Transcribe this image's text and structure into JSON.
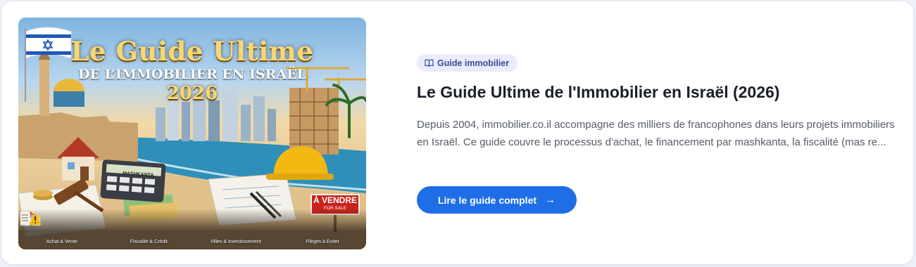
{
  "hero": {
    "title": "Le Guide Ultime",
    "subtitle": "DE L’IMMOBILIER EN ISRAËL",
    "year": "2026",
    "calculator_label": "MASHKANTA",
    "sale_sign": {
      "main": "À VENDRE",
      "sub": "FOR SALE"
    },
    "categories": [
      {
        "label": "Achat & Vente",
        "icon": "house-icon"
      },
      {
        "label": "Fiscalité & Crédit",
        "icon": "percent-coins-icon"
      },
      {
        "label": "Villes & Investissement",
        "icon": "city-icon"
      },
      {
        "label": "Pièges à Eviter",
        "icon": "warning-icon"
      }
    ]
  },
  "card": {
    "badge": {
      "icon": "book-icon",
      "label": "Guide immobilier"
    },
    "title": "Le Guide Ultime de l'Immobilier en Israël (2026)",
    "description": "Depuis 2004, immobilier.co.il accompagne des milliers de francophones dans leurs projets immobiliers en Israël. Ce guide couvre le processus d'achat, le financement par mashkanta, la fiscalité (mas re...",
    "cta": {
      "label": "Lire le guide complet",
      "icon": "arrow-right-icon"
    }
  },
  "colors": {
    "accent": "#1f6ee8",
    "badge_bg": "#e8ecfb",
    "badge_text": "#3b4a9a",
    "title": "#1b1f2a",
    "body_text": "#555b66",
    "hero_gold": "#f7d774",
    "sale_red": "#c8231c"
  }
}
